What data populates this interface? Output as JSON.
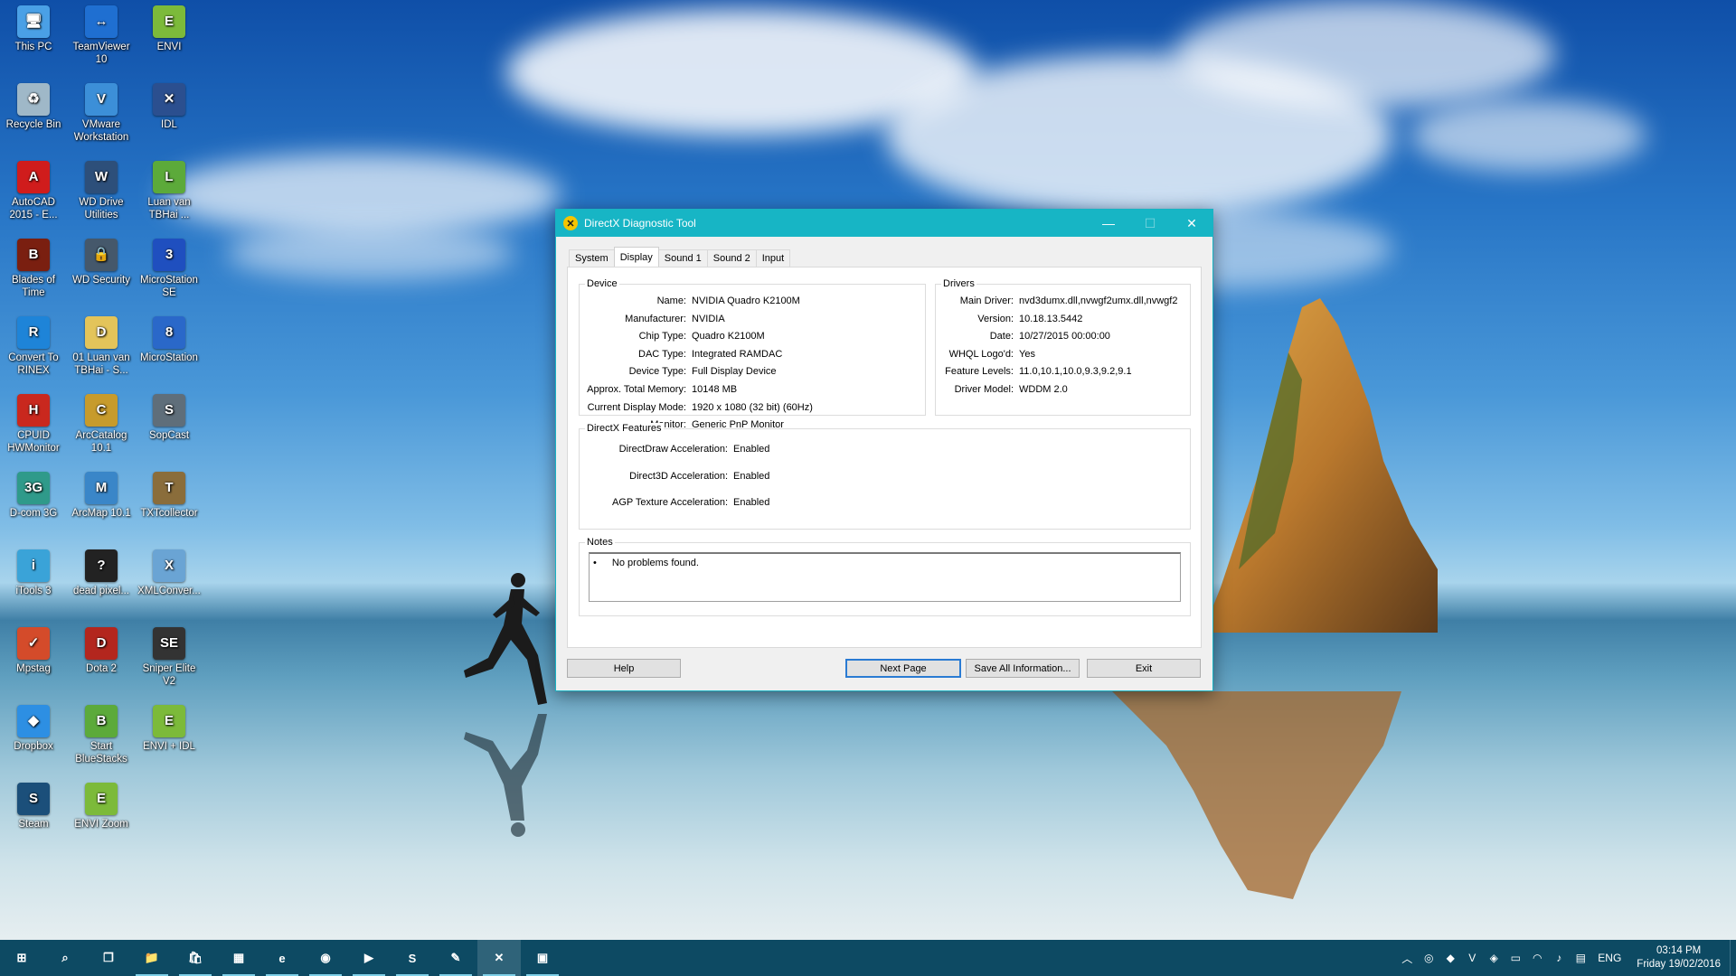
{
  "desktop": {
    "icons": [
      {
        "label": "This PC",
        "icon": "this-pc-icon",
        "color": "#4aa0e6",
        "glyph": "🖥"
      },
      {
        "label": "TeamViewer 10",
        "icon": "teamviewer-icon",
        "color": "#1f6fd1",
        "glyph": "↔"
      },
      {
        "label": "ENVI",
        "icon": "envi-icon",
        "color": "#7cba3a",
        "glyph": "E"
      },
      {
        "label": "Recycle Bin",
        "icon": "recycle-bin-icon",
        "color": "#9fb8c8",
        "glyph": "♻"
      },
      {
        "label": "VMware Workstation",
        "icon": "vmware-icon",
        "color": "#3c8fd8",
        "glyph": "V"
      },
      {
        "label": "IDL",
        "icon": "idl-icon",
        "color": "#2b4f8f",
        "glyph": "✕"
      },
      {
        "label": "AutoCAD 2015 - E...",
        "icon": "autocad-icon",
        "color": "#d01c1c",
        "glyph": "A"
      },
      {
        "label": "WD Drive Utilities",
        "icon": "wd-drive-icon",
        "color": "#2d4f7a",
        "glyph": "W"
      },
      {
        "label": "Luan van TBHai ...",
        "icon": "luan-van-shortcut-icon",
        "color": "#5caa3a",
        "glyph": "L"
      },
      {
        "label": "Blades of Time",
        "icon": "blades-of-time-icon",
        "color": "#7a1f10",
        "glyph": "B"
      },
      {
        "label": "WD Security",
        "icon": "wd-security-icon",
        "color": "#45586b",
        "glyph": "🔒"
      },
      {
        "label": "MicroStation SE",
        "icon": "microstation-se-icon",
        "color": "#1f4fbf",
        "glyph": "3"
      },
      {
        "label": "Convert To RINEX",
        "icon": "convert-rinex-icon",
        "color": "#1e84d8",
        "glyph": "R"
      },
      {
        "label": "01 Luan van TBHai - S...",
        "icon": "document-icon",
        "color": "#e3c45a",
        "glyph": "D"
      },
      {
        "label": "MicroStation",
        "icon": "microstation-icon",
        "color": "#2a68c9",
        "glyph": "8"
      },
      {
        "label": "CPUID HWMonitor",
        "icon": "hwmonitor-icon",
        "color": "#c9281e",
        "glyph": "H"
      },
      {
        "label": "ArcCatalog 10.1",
        "icon": "arccatalog-icon",
        "color": "#c79b2c",
        "glyph": "C"
      },
      {
        "label": "SopCast",
        "icon": "sopcast-icon",
        "color": "#5f6e7a",
        "glyph": "S"
      },
      {
        "label": "D-com 3G",
        "icon": "dcom-3g-icon",
        "color": "#2f9a8a",
        "glyph": "3G"
      },
      {
        "label": "ArcMap 10.1",
        "icon": "arcmap-icon",
        "color": "#3a86c8",
        "glyph": "M"
      },
      {
        "label": "TXTcollector",
        "icon": "txtcollector-icon",
        "color": "#8a6d3b",
        "glyph": "T"
      },
      {
        "label": "iTools 3",
        "icon": "itools-icon",
        "color": "#3aa3d8",
        "glyph": "i"
      },
      {
        "label": "dead pixel...",
        "icon": "dead-pixel-icon",
        "color": "#222222",
        "glyph": "?"
      },
      {
        "label": "XMLConver...",
        "icon": "xml-converter-icon",
        "color": "#6aa4d4",
        "glyph": "X"
      },
      {
        "label": "Mpstag",
        "icon": "mpstag-icon",
        "color": "#d44b2a",
        "glyph": "✓"
      },
      {
        "label": "Dota 2",
        "icon": "dota2-icon",
        "color": "#b3261e",
        "glyph": "D"
      },
      {
        "label": "Sniper Elite V2",
        "icon": "sniper-elite-icon",
        "color": "#333333",
        "glyph": "SE"
      },
      {
        "label": "Dropbox",
        "icon": "dropbox-icon",
        "color": "#2d8fe3",
        "glyph": "◆"
      },
      {
        "label": "Start BlueStacks",
        "icon": "bluestacks-icon",
        "color": "#5caa3a",
        "glyph": "B"
      },
      {
        "label": "ENVI + IDL",
        "icon": "envi-idl-icon",
        "color": "#7cba3a",
        "glyph": "E"
      },
      {
        "label": "Steam",
        "icon": "steam-icon",
        "color": "#1b4f7a",
        "glyph": "S"
      },
      {
        "label": "ENVI Zoom",
        "icon": "envi-zoom-icon",
        "color": "#7cba3a",
        "glyph": "E"
      }
    ]
  },
  "dialog": {
    "title": "DirectX Diagnostic Tool",
    "tabs": [
      "System",
      "Display",
      "Sound 1",
      "Sound 2",
      "Input"
    ],
    "active_tab": "Display",
    "device": {
      "title": "Device",
      "rows": [
        {
          "k": "Name:",
          "v": "NVIDIA Quadro K2100M"
        },
        {
          "k": "Manufacturer:",
          "v": "NVIDIA"
        },
        {
          "k": "Chip Type:",
          "v": "Quadro K2100M"
        },
        {
          "k": "DAC Type:",
          "v": "Integrated RAMDAC"
        },
        {
          "k": "Device Type:",
          "v": "Full Display Device"
        },
        {
          "k": "Approx. Total Memory:",
          "v": "10148 MB"
        },
        {
          "k": "Current Display Mode:",
          "v": "1920 x 1080 (32 bit) (60Hz)"
        },
        {
          "k": "Monitor:",
          "v": "Generic PnP Monitor"
        }
      ]
    },
    "drivers": {
      "title": "Drivers",
      "rows": [
        {
          "k": "Main Driver:",
          "v": "nvd3dumx.dll,nvwgf2umx.dll,nvwgf2"
        },
        {
          "k": "Version:",
          "v": "10.18.13.5442"
        },
        {
          "k": "Date:",
          "v": "10/27/2015 00:00:00"
        },
        {
          "k": "WHQL Logo'd:",
          "v": "Yes"
        },
        {
          "k": "Feature Levels:",
          "v": "11.0,10.1,10.0,9.3,9.2,9.1"
        },
        {
          "k": "Driver Model:",
          "v": "WDDM 2.0"
        }
      ]
    },
    "features": {
      "title": "DirectX Features",
      "rows": [
        {
          "k": "DirectDraw Acceleration:",
          "v": "Enabled"
        },
        {
          "k": "Direct3D Acceleration:",
          "v": "Enabled"
        },
        {
          "k": "AGP Texture Acceleration:",
          "v": "Enabled"
        }
      ]
    },
    "notes": {
      "title": "Notes",
      "items": [
        "No problems found."
      ]
    },
    "buttons": {
      "help": "Help",
      "next_page": "Next Page",
      "save_all": "Save All Information...",
      "exit": "Exit"
    }
  },
  "taskbar": {
    "items": [
      {
        "icon": "windows-start-icon",
        "glyph": "⊞"
      },
      {
        "icon": "search-icon",
        "glyph": "⌕"
      },
      {
        "icon": "task-view-icon",
        "glyph": "❐"
      },
      {
        "icon": "file-explorer-icon",
        "glyph": "📁"
      },
      {
        "icon": "store-icon",
        "glyph": "🛍"
      },
      {
        "icon": "calendar-app-icon",
        "glyph": "▦"
      },
      {
        "icon": "edge-icon",
        "glyph": "e"
      },
      {
        "icon": "chrome-icon",
        "glyph": "◉"
      },
      {
        "icon": "media-player-icon",
        "glyph": "▶"
      },
      {
        "icon": "skype-icon",
        "glyph": "S"
      },
      {
        "icon": "feather-app-icon",
        "glyph": "✎"
      },
      {
        "icon": "directx-diag-icon",
        "glyph": "✕"
      },
      {
        "icon": "remote-desktop-icon",
        "glyph": "▣"
      }
    ],
    "tray": {
      "icons": [
        "chevron-up-icon",
        "steam-tray-icon",
        "dropbox-tray-icon",
        "vivaldi-tray-icon",
        "shield-tray-icon",
        "battery-icon",
        "wifi-icon",
        "volume-icon",
        "message-icon"
      ],
      "language": "ENG",
      "time": "03:14 PM",
      "date": "Friday 19/02/2016"
    }
  },
  "colors": {
    "titlebar": "#17b5c5",
    "taskbar": "#0d4a63",
    "default_button_border": "#2a7bd3"
  }
}
